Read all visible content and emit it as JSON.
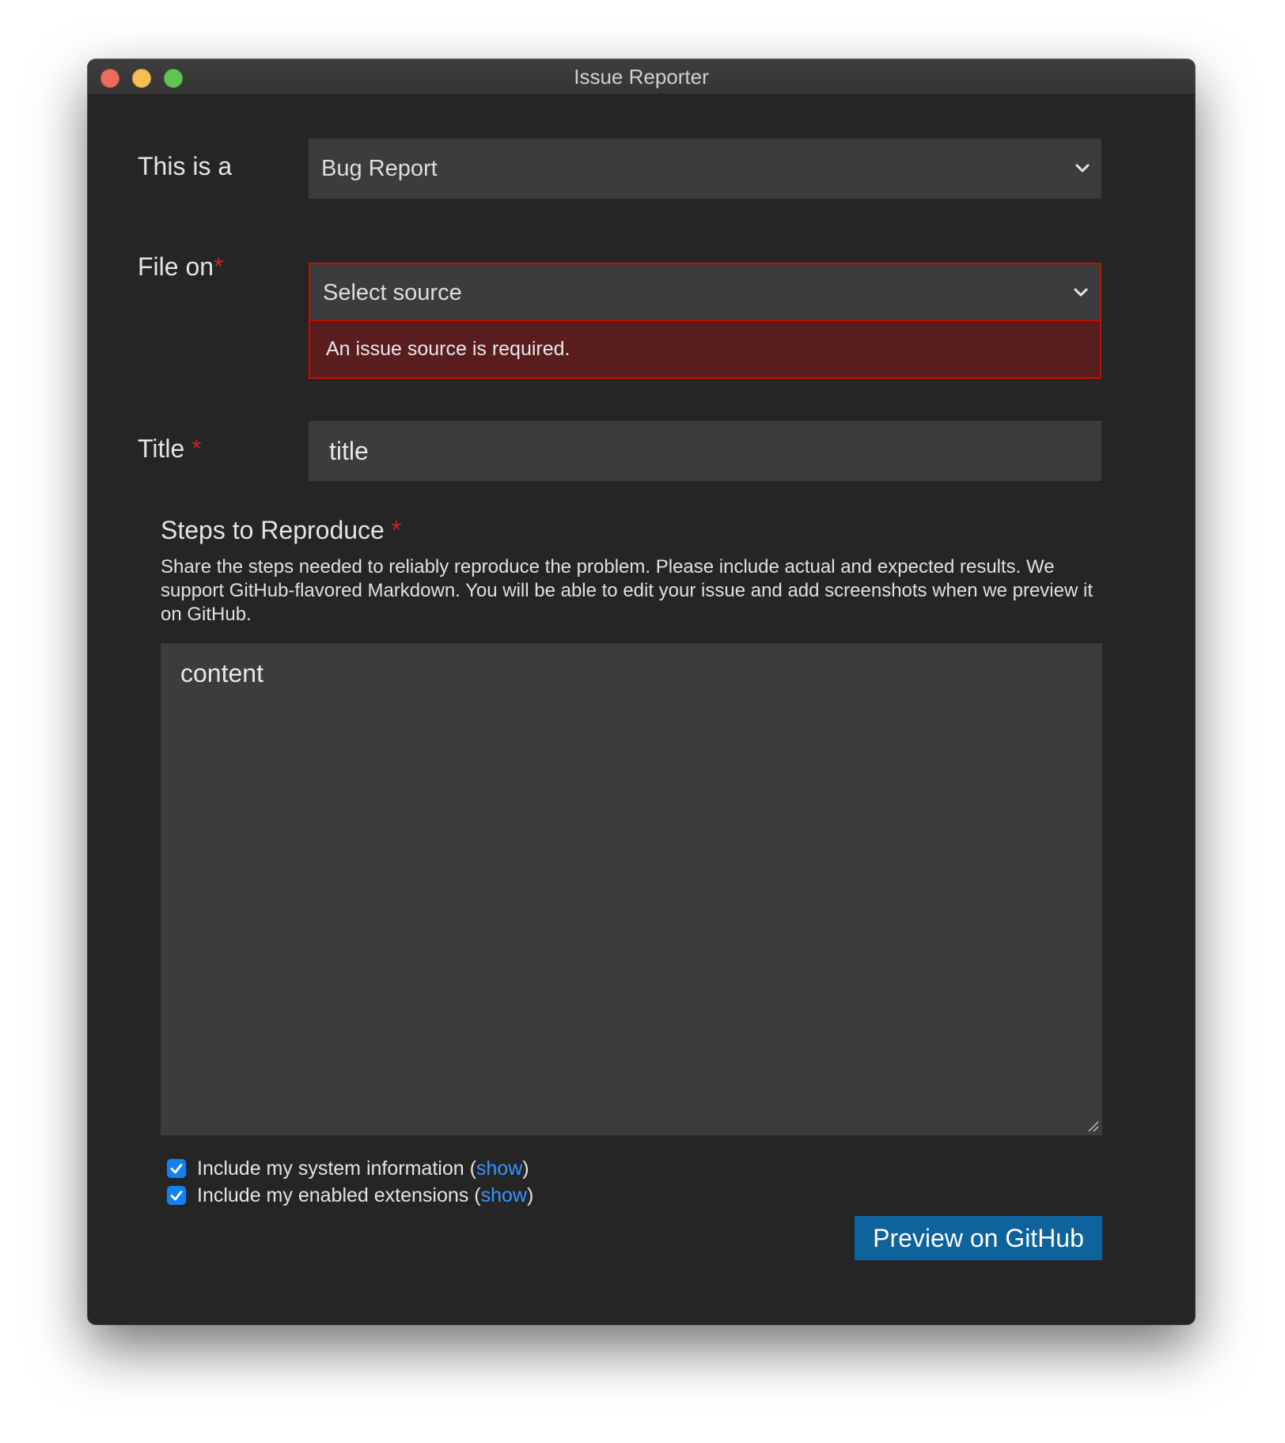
{
  "window": {
    "title": "Issue Reporter"
  },
  "issue_type": {
    "label": "This is a",
    "selected": "Bug Report"
  },
  "file_on": {
    "label": "File on",
    "required_marker": "*",
    "selected": "Select source",
    "error": "An issue source is required."
  },
  "title_field": {
    "label": "Title",
    "required_marker": "*",
    "value": "title"
  },
  "steps": {
    "heading": "Steps to Reproduce",
    "required_marker": "*",
    "description": "Share the steps needed to reliably reproduce the problem. Please include actual and expected results. We support GitHub-flavored Markdown. You will be able to edit your issue and add screenshots when we preview it on GitHub.",
    "value": "content"
  },
  "options": [
    {
      "checked": true,
      "label": "Include my system information",
      "open_paren": "(",
      "link": "show",
      "close_paren": ")"
    },
    {
      "checked": true,
      "label": "Include my enabled extensions",
      "open_paren": "(",
      "link": "show",
      "close_paren": ")"
    }
  ],
  "actions": {
    "preview_label": "Preview on GitHub"
  },
  "colors": {
    "window_bg": "#252526",
    "input_bg": "#3c3c3c",
    "error_border": "#be1100",
    "error_bg": "#5a1d1d",
    "required": "#cc2222",
    "link": "#3794ff",
    "checkbox": "#1580f0",
    "button_bg": "#0e639c"
  }
}
